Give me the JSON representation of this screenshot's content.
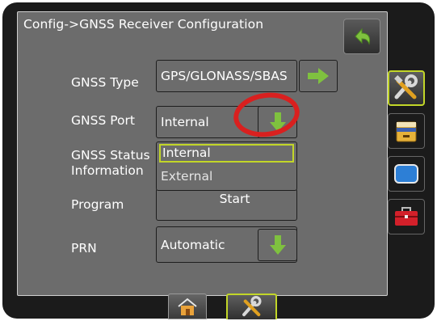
{
  "header": {
    "title": "Config->GNSS Receiver Configuration"
  },
  "form": {
    "gnss_type": {
      "label": "GNSS Type",
      "value": "GPS/GLONASS/SBAS"
    },
    "gnss_port": {
      "label": "GNSS Port",
      "value": "Internal"
    },
    "gnss_status": {
      "label_line1": "GNSS Status",
      "label_line2": "Information"
    },
    "program": {
      "label": "Program",
      "button_label": "Start"
    },
    "prn": {
      "label": "PRN",
      "value": "Automatic"
    }
  },
  "port_dropdown": {
    "options": [
      "Internal",
      "External"
    ],
    "selected": "Internal"
  },
  "sidebar": {
    "items": [
      {
        "icon": "tools-icon",
        "active": true
      },
      {
        "icon": "file-cabinet-icon",
        "active": false
      },
      {
        "icon": "display-icon",
        "active": false
      },
      {
        "icon": "toolbox-icon",
        "active": false
      }
    ]
  },
  "bottom_tabs": [
    {
      "icon": "home-icon",
      "active": false
    },
    {
      "icon": "tools-icon",
      "active": true
    }
  ],
  "colors": {
    "panel": "#6c6c6c",
    "frame": "#1b1b1b",
    "accent_green": "#7fc13f",
    "selection_outline": "#c2d628",
    "annotation_circle": "#d9201f"
  }
}
